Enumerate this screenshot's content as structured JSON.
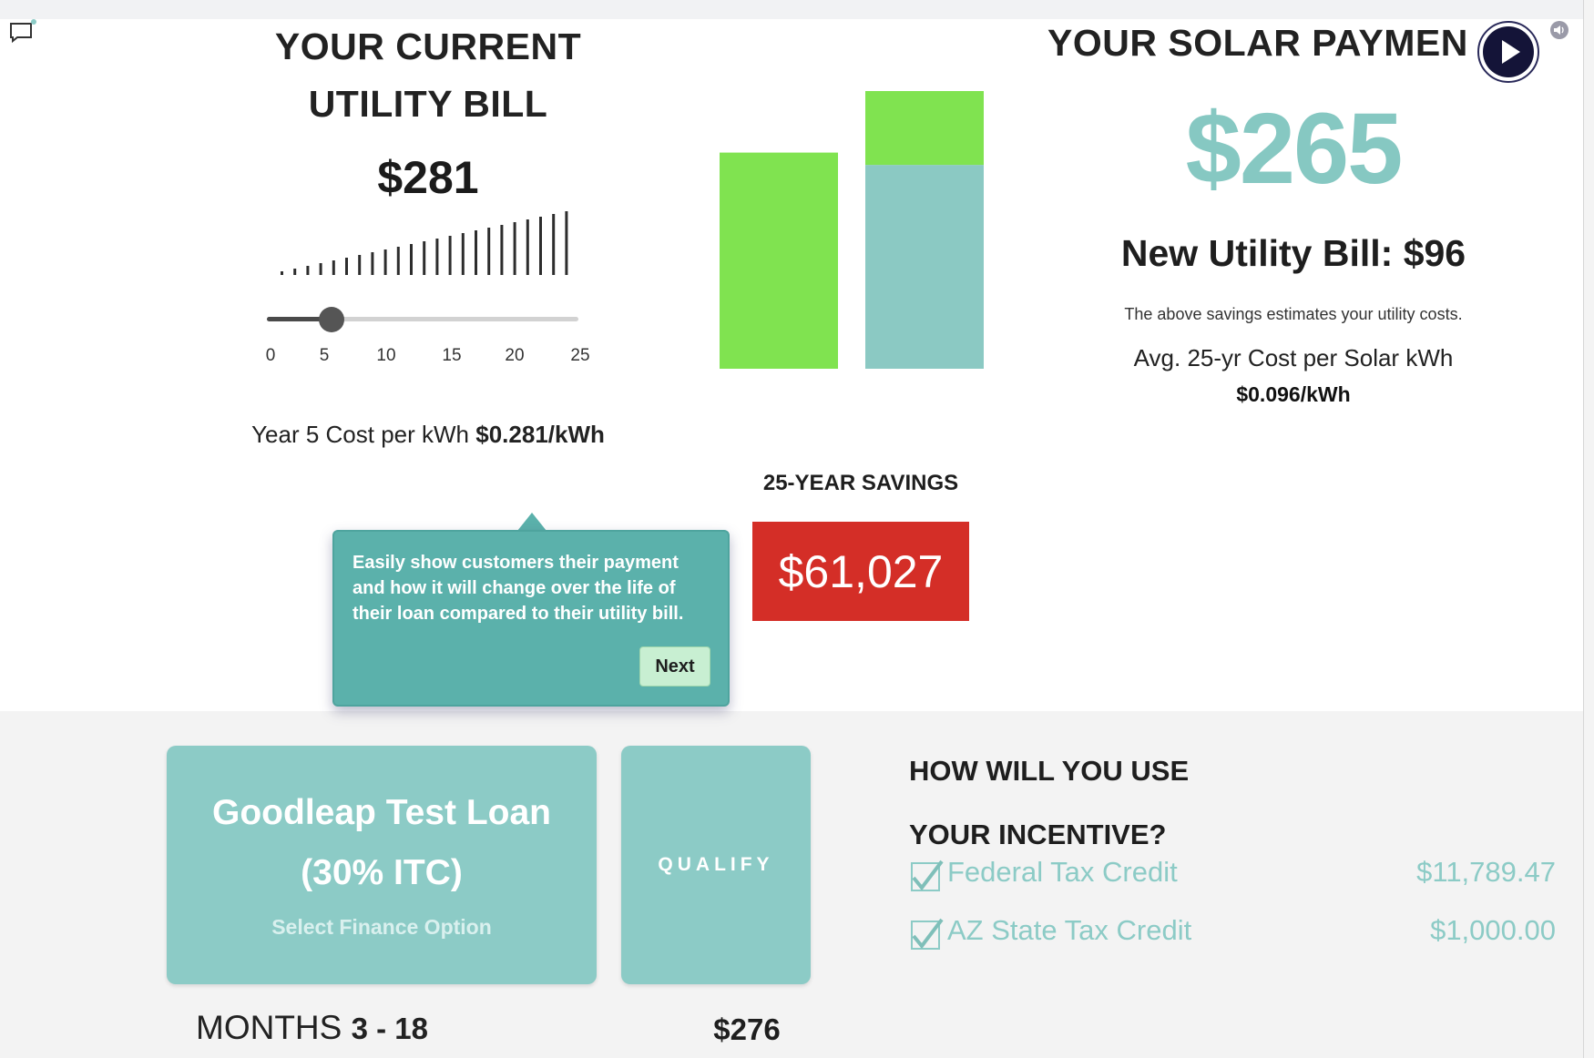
{
  "current_bill": {
    "heading": "YOUR CURRENT UTILITY BILL",
    "amount": "$281",
    "slider": {
      "ticks": [
        "0",
        "5",
        "10",
        "15",
        "20",
        "25"
      ],
      "value": 5,
      "min": 0,
      "max": 25
    },
    "year_cost_label": "Year 5 Cost per kWh",
    "year_cost_value": "$0.281/kWh"
  },
  "solar_payment": {
    "heading": "YOUR SOLAR PAYMEN",
    "amount": "$265",
    "new_bill": "New Utility Bill: $96",
    "note": "The above savings estimates your utility costs.",
    "avg_cost_label": "Avg. 25-yr Cost per Solar kWh",
    "avg_cost_value": "$0.096/kWh"
  },
  "chart_data": {
    "type": "bar",
    "categories": [
      "",
      ""
    ],
    "series": [
      {
        "values": [
          281,
          0
        ],
        "color": "#80e350"
      },
      {
        "values": [
          0,
          265
        ],
        "color": "#8bc9c3"
      },
      {
        "values": [
          0,
          96
        ],
        "color": "#80e350"
      }
    ],
    "stacked": true,
    "ylim": [
      0,
      361
    ],
    "title": "",
    "xlabel": "",
    "ylabel": ""
  },
  "savings": {
    "title": "25-YEAR SAVINGS",
    "amount": "$61,027",
    "color": "#d42e27"
  },
  "tooltip": {
    "text": "Easily show customers their payment and how it will change over the life of their loan compared to their utility bill.",
    "next_label": "Next"
  },
  "loan": {
    "title_line1": "Goodleap Test Loan",
    "title_line2": "(30% ITC)",
    "subtitle": "Select Finance Option",
    "qualify_label": "QUALIFY",
    "months_label": "MONTHS",
    "months_range": "3 - 18",
    "monthly_amount": "$276"
  },
  "incentives": {
    "title_line1": "HOW WILL YOU USE",
    "title_line2": "YOUR INCENTIVE?",
    "items": [
      {
        "label": "Federal Tax Credit",
        "value": "$11,789.47",
        "checked": true
      },
      {
        "label": "AZ State Tax Credit",
        "value": "$1,000.00",
        "checked": true
      }
    ]
  },
  "icons": {
    "comment": "comment-icon",
    "play": "play-icon",
    "mute": "speaker-icon"
  },
  "colors": {
    "accent": "#8ccbc6",
    "green": "#80e350",
    "red": "#d42e27",
    "tooltip": "#5bb1ab"
  }
}
